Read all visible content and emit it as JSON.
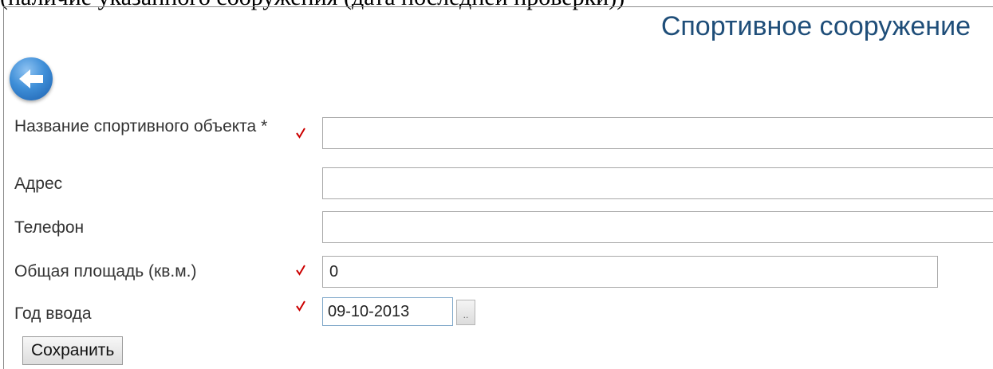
{
  "caption_fragment": "(наличие указанного сооружения (дата последней проверки))",
  "page_title": "Спортивное сооружение",
  "back_button_icon": "arrow-left-icon",
  "required_marker_icon": "check-mark-icon",
  "required_marker_color": "#cc0000",
  "form": {
    "name_label": "Название спортивного объекта *",
    "name_value": "",
    "address_label": "Адрес",
    "address_value": "",
    "phone_label": "Телефон",
    "phone_value": "",
    "area_label": "Общая площадь (кв.м.)",
    "area_value": "0",
    "year_label": "Год ввода",
    "year_value": "09-10-2013",
    "date_picker_label": "..",
    "save_label": "Сохранить"
  }
}
